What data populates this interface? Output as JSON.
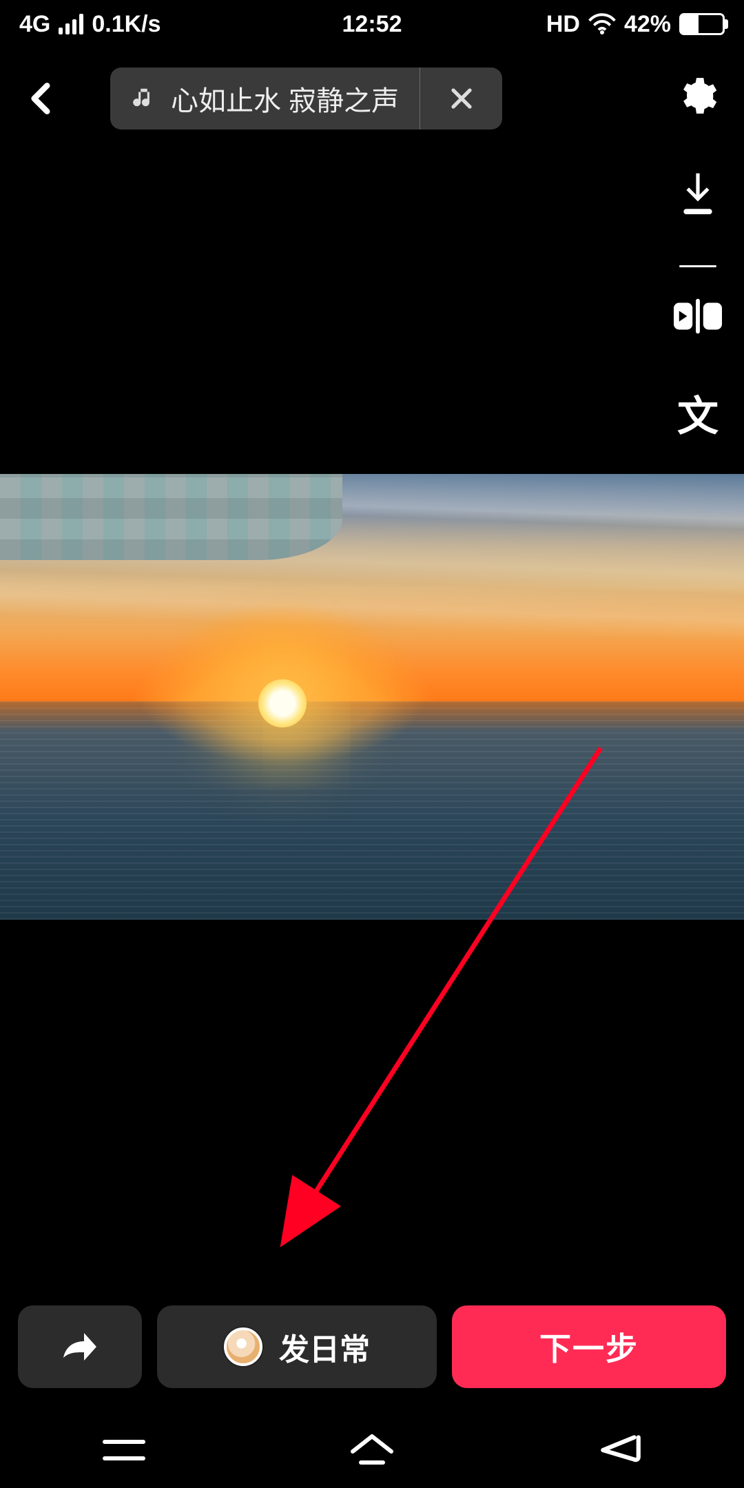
{
  "statusbar": {
    "network_label": "4G",
    "speed": "0.1K/s",
    "time": "12:52",
    "hd": "HD",
    "battery_pct": "42%"
  },
  "topbar": {
    "music_title": "心如止水 寂静之声"
  },
  "right_tools": {
    "text_icon_label": "文"
  },
  "bottom": {
    "daily_label": "发日常",
    "next_label": "下一步"
  },
  "colors": {
    "accent": "#ff2b54",
    "arrow": "#ff0022"
  }
}
